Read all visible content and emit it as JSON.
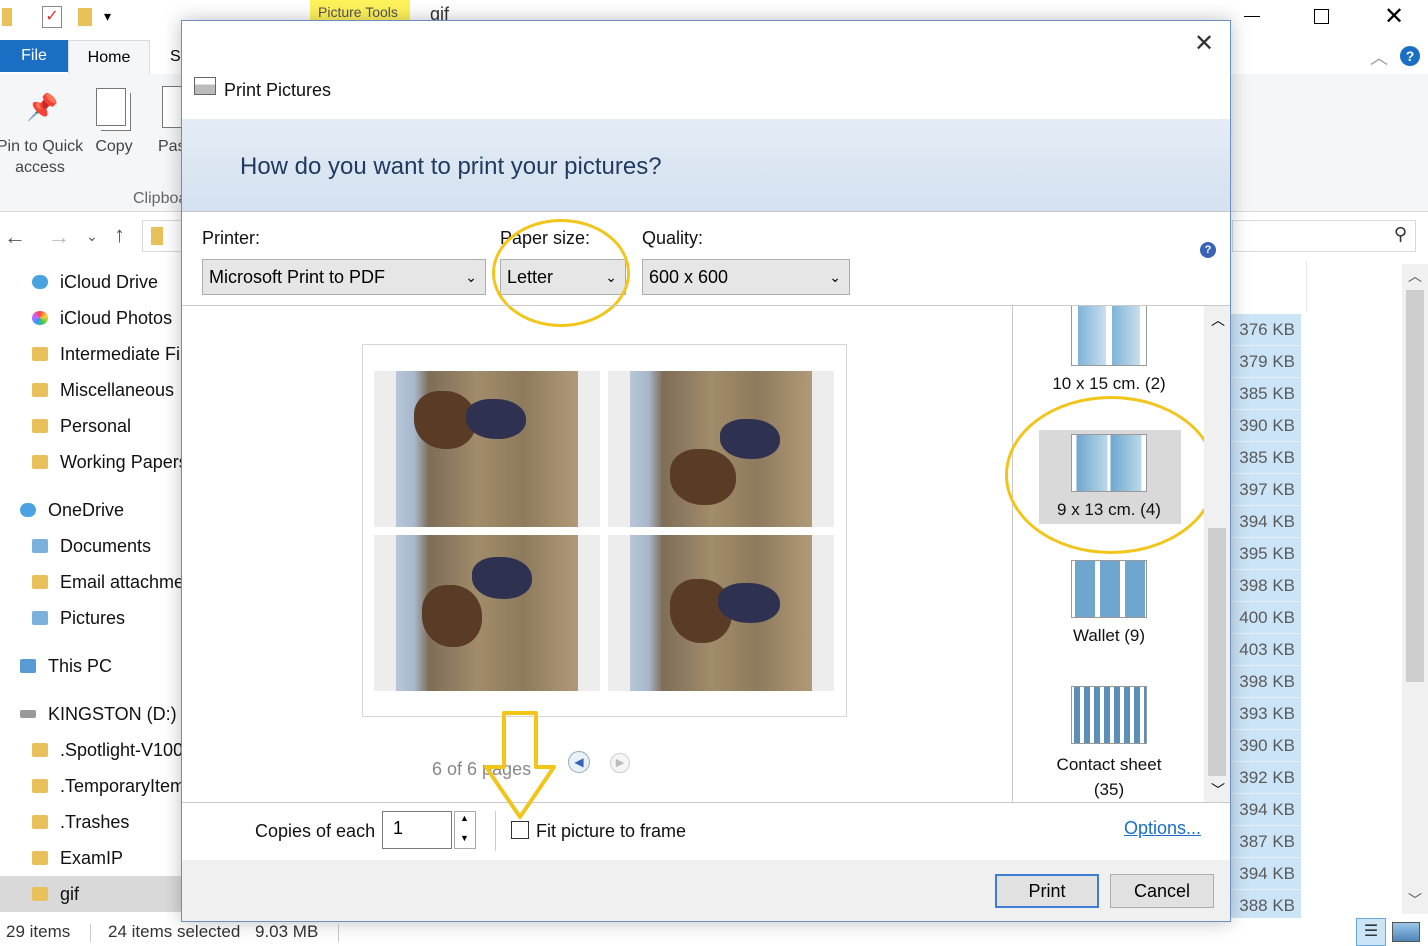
{
  "explorer": {
    "title": "gif",
    "picture_tools_tab": "Picture Tools",
    "tabs": {
      "file": "File",
      "home": "Home",
      "share_partial": "S"
    },
    "ribbon": {
      "pin": "Pin to Quick access",
      "copy": "Copy",
      "paste_partial": "Pas",
      "clipboard_partial": "Clipboa"
    },
    "tree": [
      {
        "label": "iCloud Drive",
        "icon": "icloud-drive-icon"
      },
      {
        "label": "iCloud Photos",
        "icon": "icloud-photos-icon"
      },
      {
        "label": "Intermediate Fi",
        "icon": "folder-icon"
      },
      {
        "label": "Miscellaneous",
        "icon": "folder-icon"
      },
      {
        "label": "Personal",
        "icon": "folder-icon"
      },
      {
        "label": "Working Papers",
        "icon": "folder-icon"
      },
      {
        "label": "OneDrive",
        "icon": "onedrive-icon"
      },
      {
        "label": "Documents",
        "icon": "documents-icon"
      },
      {
        "label": "Email attachme",
        "icon": "folder-icon"
      },
      {
        "label": "Pictures",
        "icon": "pictures-icon"
      },
      {
        "label": "This PC",
        "icon": "pc-icon"
      },
      {
        "label": "KINGSTON (D:)",
        "icon": "drive-icon"
      },
      {
        "label": ".Spotlight-V100",
        "icon": "folder-icon"
      },
      {
        "label": ".TemporaryItem",
        "icon": "folder-icon"
      },
      {
        "label": ".Trashes",
        "icon": "folder-icon"
      },
      {
        "label": "ExamIP",
        "icon": "folder-icon"
      },
      {
        "label": "gif",
        "icon": "folder-icon"
      }
    ],
    "sizes": [
      "376 KB",
      "379 KB",
      "385 KB",
      "390 KB",
      "385 KB",
      "397 KB",
      "394 KB",
      "395 KB",
      "398 KB",
      "400 KB",
      "403 KB",
      "398 KB",
      "393 KB",
      "390 KB",
      "392 KB",
      "394 KB",
      "387 KB",
      "394 KB",
      "388 KB"
    ],
    "status": {
      "items": "29 items",
      "selected": "24 items selected",
      "size": "9.03 MB"
    }
  },
  "dialog": {
    "title": "Print Pictures",
    "question": "How do you want to print your pictures?",
    "printer_label": "Printer:",
    "printer_value": "Microsoft Print to PDF",
    "paper_label": "Paper size:",
    "paper_value": "Letter",
    "quality_label": "Quality:",
    "quality_value": "600 x 600",
    "page_indicator": "6 of 6 pages",
    "layouts": [
      {
        "label": "10 x 15 cm. (2)"
      },
      {
        "label": "9 x 13 cm. (4)",
        "selected": true
      },
      {
        "label": "Wallet (9)"
      },
      {
        "label": "Contact sheet (35)"
      }
    ],
    "copies_label": "Copies of each",
    "copies_value": "1",
    "fit_label": "Fit picture to frame",
    "fit_checked": false,
    "options_link": "Options...",
    "print_button": "Print",
    "cancel_button": "Cancel"
  },
  "colors": {
    "highlight": "#f2c51b",
    "accent": "#1a6fc4"
  }
}
